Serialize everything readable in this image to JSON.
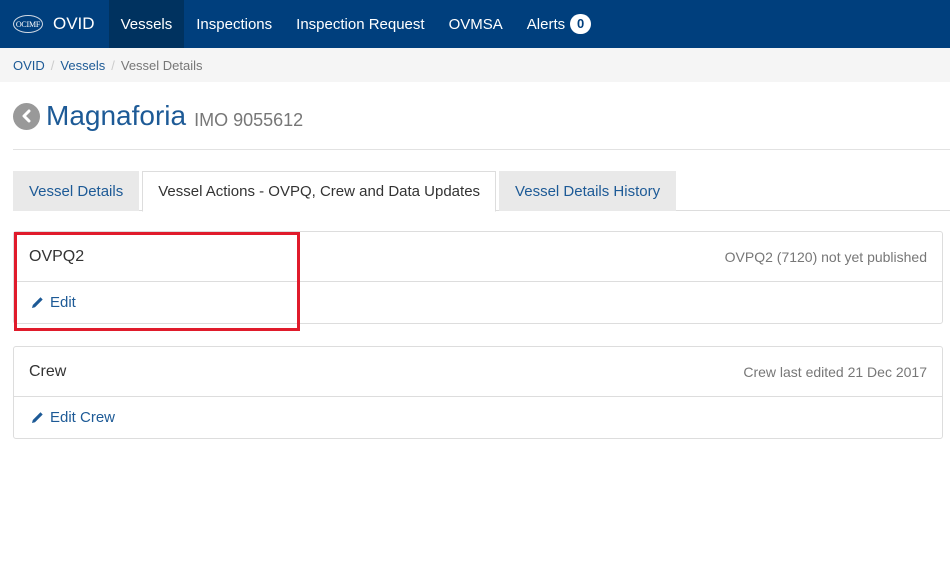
{
  "navbar": {
    "brand_logo": "OCIMF",
    "brand_text": "OVID",
    "items": [
      {
        "label": "Vessels",
        "active": true
      },
      {
        "label": "Inspections"
      },
      {
        "label": "Inspection Request"
      },
      {
        "label": "OVMSA"
      },
      {
        "label": "Alerts",
        "badge": "0"
      }
    ]
  },
  "breadcrumb": {
    "items": [
      "OVID",
      "Vessels",
      "Vessel Details"
    ],
    "separator": "/"
  },
  "header": {
    "vessel_name": "Magnaforia",
    "imo": "IMO 9055612",
    "back_icon": "circle-chevron-left-icon"
  },
  "tabs": [
    {
      "label": "Vessel Details"
    },
    {
      "label": "Vessel Actions - OVPQ, Crew and Data Updates",
      "active": true
    },
    {
      "label": "Vessel Details History"
    }
  ],
  "panels": [
    {
      "title": "OVPQ2",
      "status": "OVPQ2 (7120) not yet published",
      "action_label": "Edit",
      "action_icon": "pencil-icon"
    },
    {
      "title": "Crew",
      "status": "Crew last edited 21 Dec 2017",
      "action_label": "Edit Crew",
      "action_icon": "pencil-icon"
    }
  ],
  "colors": {
    "navbar": "#003f7d",
    "link": "#1d5a96",
    "highlight": "#e01b2b"
  }
}
